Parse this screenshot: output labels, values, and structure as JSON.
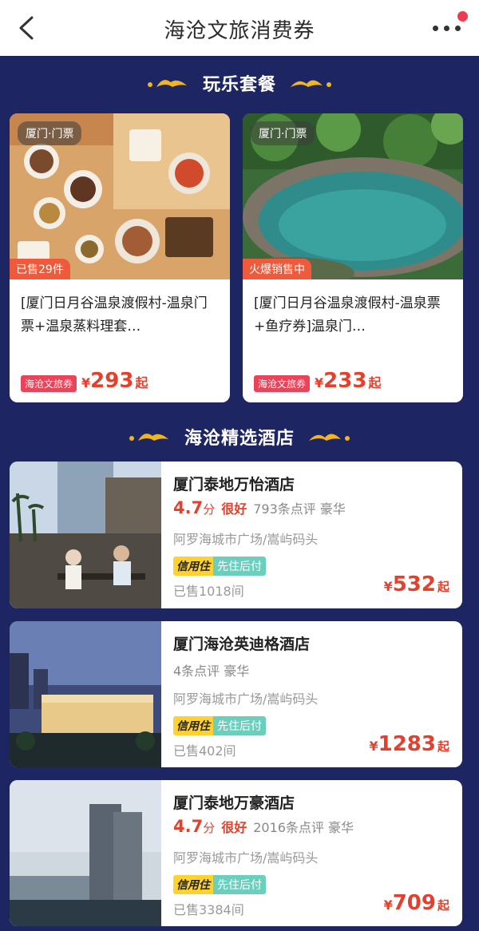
{
  "header": {
    "title": "海沧文旅消费券"
  },
  "sections": {
    "packages_title": "玩乐套餐",
    "hotels_title": "海沧精选酒店"
  },
  "packages": [
    {
      "location": "厦门·门票",
      "status": "已售29件",
      "name": "[厦门日月谷温泉渡假村-温泉门票+温泉蒸料理套…",
      "tag": "海沧文旅券",
      "currency": "¥",
      "price": "293",
      "suffix": "起"
    },
    {
      "location": "厦门·门票",
      "status": "火爆销售中",
      "name": "[厦门日月谷温泉渡假村-温泉票+鱼疗券]温泉门…",
      "tag": "海沧文旅券",
      "currency": "¥",
      "price": "233",
      "suffix": "起"
    }
  ],
  "hotels": [
    {
      "name": "厦门泰地万怡酒店",
      "score": "4.7",
      "score_unit": "分",
      "level": "很好",
      "reviews": "793条点评 豪华",
      "address": "阿罗海城市广场/嵩屿码头",
      "badge1": "信用住",
      "badge2": "先住后付",
      "sold": "已售1018间",
      "currency": "¥",
      "price": "532",
      "suffix": "起"
    },
    {
      "name": "厦门海沧英迪格酒店",
      "reviews": "4条点评 豪华",
      "address": "阿罗海城市广场/嵩屿码头",
      "badge1": "信用住",
      "badge2": "先住后付",
      "sold": "已售402间",
      "currency": "¥",
      "price": "1283",
      "suffix": "起"
    },
    {
      "name": "厦门泰地万豪酒店",
      "score": "4.7",
      "score_unit": "分",
      "level": "很好",
      "reviews": "2016条点评 豪华",
      "address": "阿罗海城市广场/嵩屿码头",
      "badge1": "信用住",
      "badge2": "先住后付",
      "sold": "已售3384间",
      "currency": "¥",
      "price": "709",
      "suffix": "起"
    }
  ],
  "icons": {
    "back": "back-chevron-icon",
    "more": "more-dots-icon"
  },
  "colors": {
    "background": "#1d2563",
    "accent": "#e5402c",
    "gold": "#f0b521"
  }
}
